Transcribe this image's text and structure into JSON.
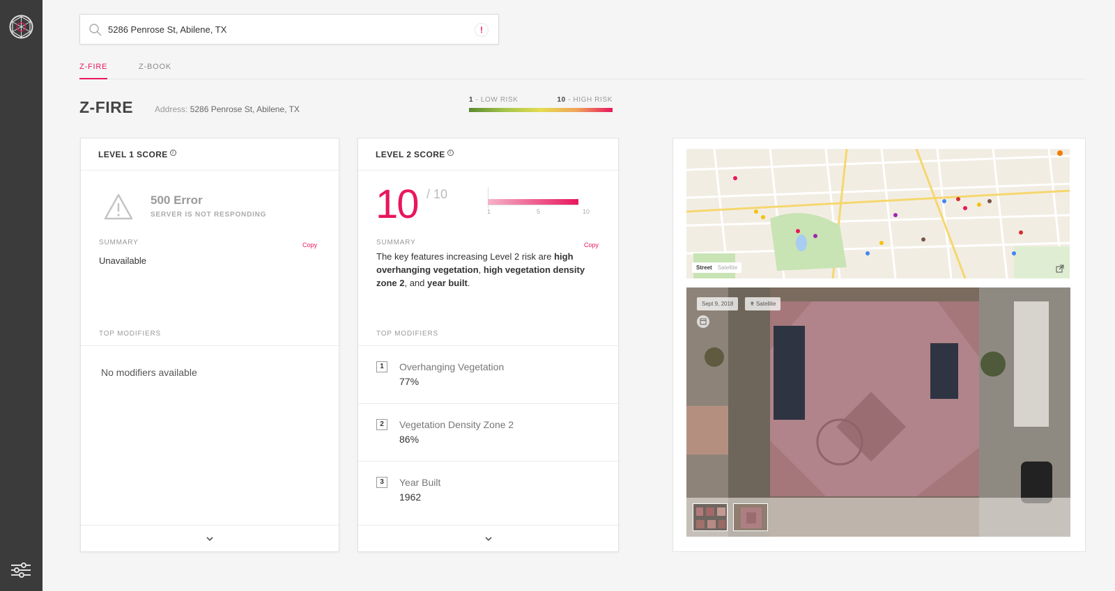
{
  "search": {
    "value": "5286 Penrose St, Abilene, TX",
    "alert": "!"
  },
  "tabs": [
    {
      "label": "Z-FIRE"
    },
    {
      "label": "Z-BOOK"
    }
  ],
  "header": {
    "title": "Z-FIRE",
    "address_label": "Address:",
    "address_value": "5286 Penrose St, Abilene, TX"
  },
  "legend": {
    "low_num": "1",
    "low_text": "- LOW RISK",
    "high_num": "10",
    "high_text": "- HIGH RISK"
  },
  "level1": {
    "title": "LEVEL 1 SCORE",
    "info": "i",
    "error_title": "500 Error",
    "error_sub": "SERVER IS NOT RESPONDING",
    "summary_label": "SUMMARY",
    "copy_label": "Copy",
    "summary_text": "Unavailable",
    "modifiers_label": "TOP MODIFIERS",
    "no_modifiers": "No modifiers available"
  },
  "level2": {
    "title": "LEVEL 2 SCORE",
    "info": "i",
    "score": "10",
    "score_max": "/ 10",
    "gauge_ticks": [
      "1",
      "5",
      "10"
    ],
    "summary_label": "SUMMARY",
    "copy_label": "Copy",
    "summary_parts": [
      "The key features increasing Level 2 risk are ",
      "high overhanging vegetation",
      ", ",
      "high vegetation density zone 2",
      ", and ",
      "year built",
      "."
    ],
    "modifiers_label": "TOP MODIFIERS",
    "modifiers": [
      {
        "num": "1",
        "name": "Overhanging Vegetation",
        "value": "77%"
      },
      {
        "num": "2",
        "name": "Vegetation Density Zone 2",
        "value": "86%"
      },
      {
        "num": "3",
        "name": "Year Built",
        "value": "1962"
      }
    ]
  },
  "imagery": {
    "map_street": "Street",
    "map_satellite": "Satellite",
    "date_chip": "Sept 9, 2018",
    "source_chip": "Satellite"
  },
  "colors": {
    "accent": "#e8175d",
    "sidebar": "#3b3b3b"
  }
}
